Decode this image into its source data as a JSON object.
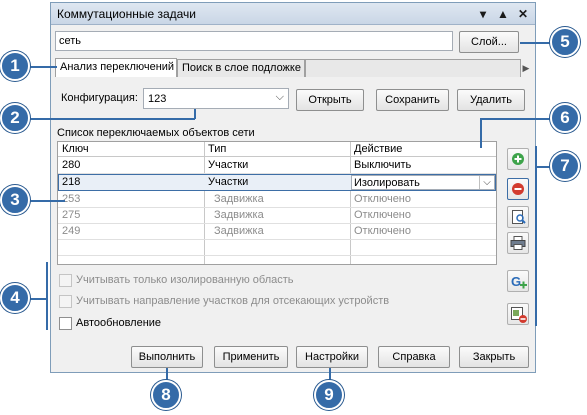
{
  "window": {
    "title": "Коммутационные задачи"
  },
  "layer": {
    "value": "сеть",
    "button_label": "Слой..."
  },
  "tabs": [
    {
      "label": "Анализ переключений",
      "active": true
    },
    {
      "label": "Поиск в слое подложке",
      "active": false
    }
  ],
  "config": {
    "label": "Конфигурация:",
    "value": "123",
    "open_label": "Открыть",
    "save_label": "Сохранить",
    "delete_label": "Удалить"
  },
  "list": {
    "title": "Список переключаемых объектов сети",
    "columns": [
      "Ключ",
      "Тип",
      "Действие"
    ],
    "rows": [
      {
        "key": "280",
        "type": "Участки",
        "action": "Выключить",
        "disabled": false
      },
      {
        "key": "218",
        "type": "Участки",
        "action": "Изолировать",
        "disabled": false,
        "selected": true
      },
      {
        "key": "253",
        "type": "Задвижка",
        "action": "Отключено",
        "disabled": true
      },
      {
        "key": "275",
        "type": "Задвижка",
        "action": "Отключено",
        "disabled": true
      },
      {
        "key": "249",
        "type": "Задвижка",
        "action": "Отключено",
        "disabled": true
      }
    ]
  },
  "options": {
    "isolated_only": "Учитывать только изолированную область",
    "cutoff_direction": "Учитывать направление участков для отсекающих устройств",
    "auto_update": "Автообновление"
  },
  "buttons": {
    "run": "Выполнить",
    "apply": "Применить",
    "settings": "Настройки",
    "help": "Справка",
    "close": "Закрыть"
  },
  "badges": [
    "1",
    "2",
    "3",
    "4",
    "5",
    "6",
    "7",
    "8",
    "9"
  ],
  "colors": {
    "badge": "#356ba8",
    "selection_border": "#3d6ea6"
  }
}
